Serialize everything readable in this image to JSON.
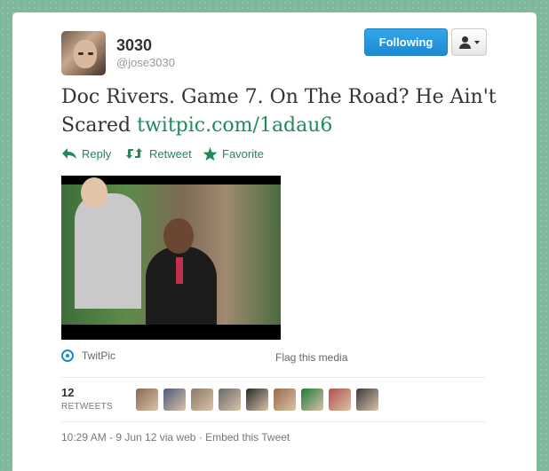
{
  "user": {
    "name": "3030",
    "handle": "@jose3030"
  },
  "buttons": {
    "following": "Following"
  },
  "tweet": {
    "text": "Doc Rivers. Game 7. On The Road? He Ain't Scared ",
    "link": "twitpic.com/1adau6"
  },
  "actions": [
    {
      "label": "Reply",
      "icon": "reply-icon"
    },
    {
      "label": "Retweet",
      "icon": "retweet-icon"
    },
    {
      "label": "Favorite",
      "icon": "star-icon"
    }
  ],
  "media": {
    "source": "TwitPic",
    "flag": "Flag this media"
  },
  "stats": {
    "retweet_count": "12",
    "retweet_label": "RETWEETS"
  },
  "meta": {
    "timestamp": "10:29 AM - 9 Jun 12 via web · Embed this Tweet"
  },
  "retweeter_colors": [
    "#8a6a50",
    "#4a5a7a",
    "#8a7a6a",
    "#6a6a6a",
    "#2a2a2a",
    "#9a6a4a",
    "#1f7a3a",
    "#b05050",
    "#3a3a3a"
  ],
  "colors": {
    "accent": "#1f8a5a",
    "button": "#1e88d3"
  }
}
